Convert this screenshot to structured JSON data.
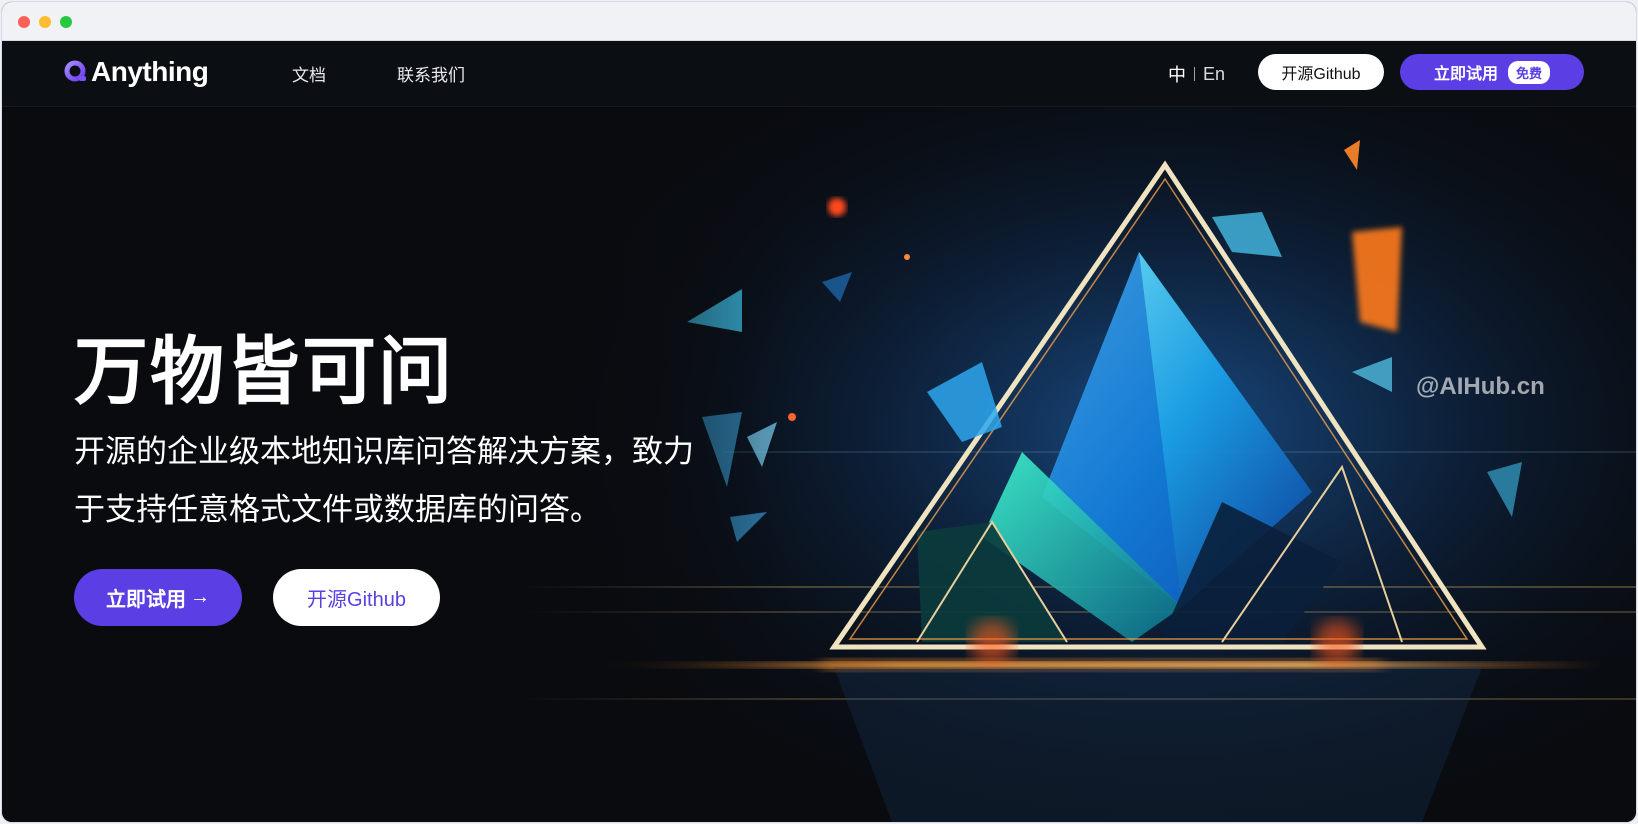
{
  "brand": {
    "name": "Anything",
    "logo_icon": "q-ring-logo-icon",
    "accent": "#5b3fe4"
  },
  "nav": {
    "links": [
      "文档",
      "联系我们"
    ],
    "lang_zh": "中",
    "lang_en": "En",
    "github_button": "开源Github",
    "try_button": "立即试用",
    "free_badge": "免费"
  },
  "hero": {
    "title": "万物皆可问",
    "subtitle": "开源的企业级本地知识库问答解决方案，致力于支持任意格式文件或数据库的问答。",
    "try_button": "立即试用",
    "try_arrow": "→",
    "github_button": "开源Github",
    "illustration": "glowing-crystal-pyramid"
  },
  "watermark": "@AIHub.cn"
}
